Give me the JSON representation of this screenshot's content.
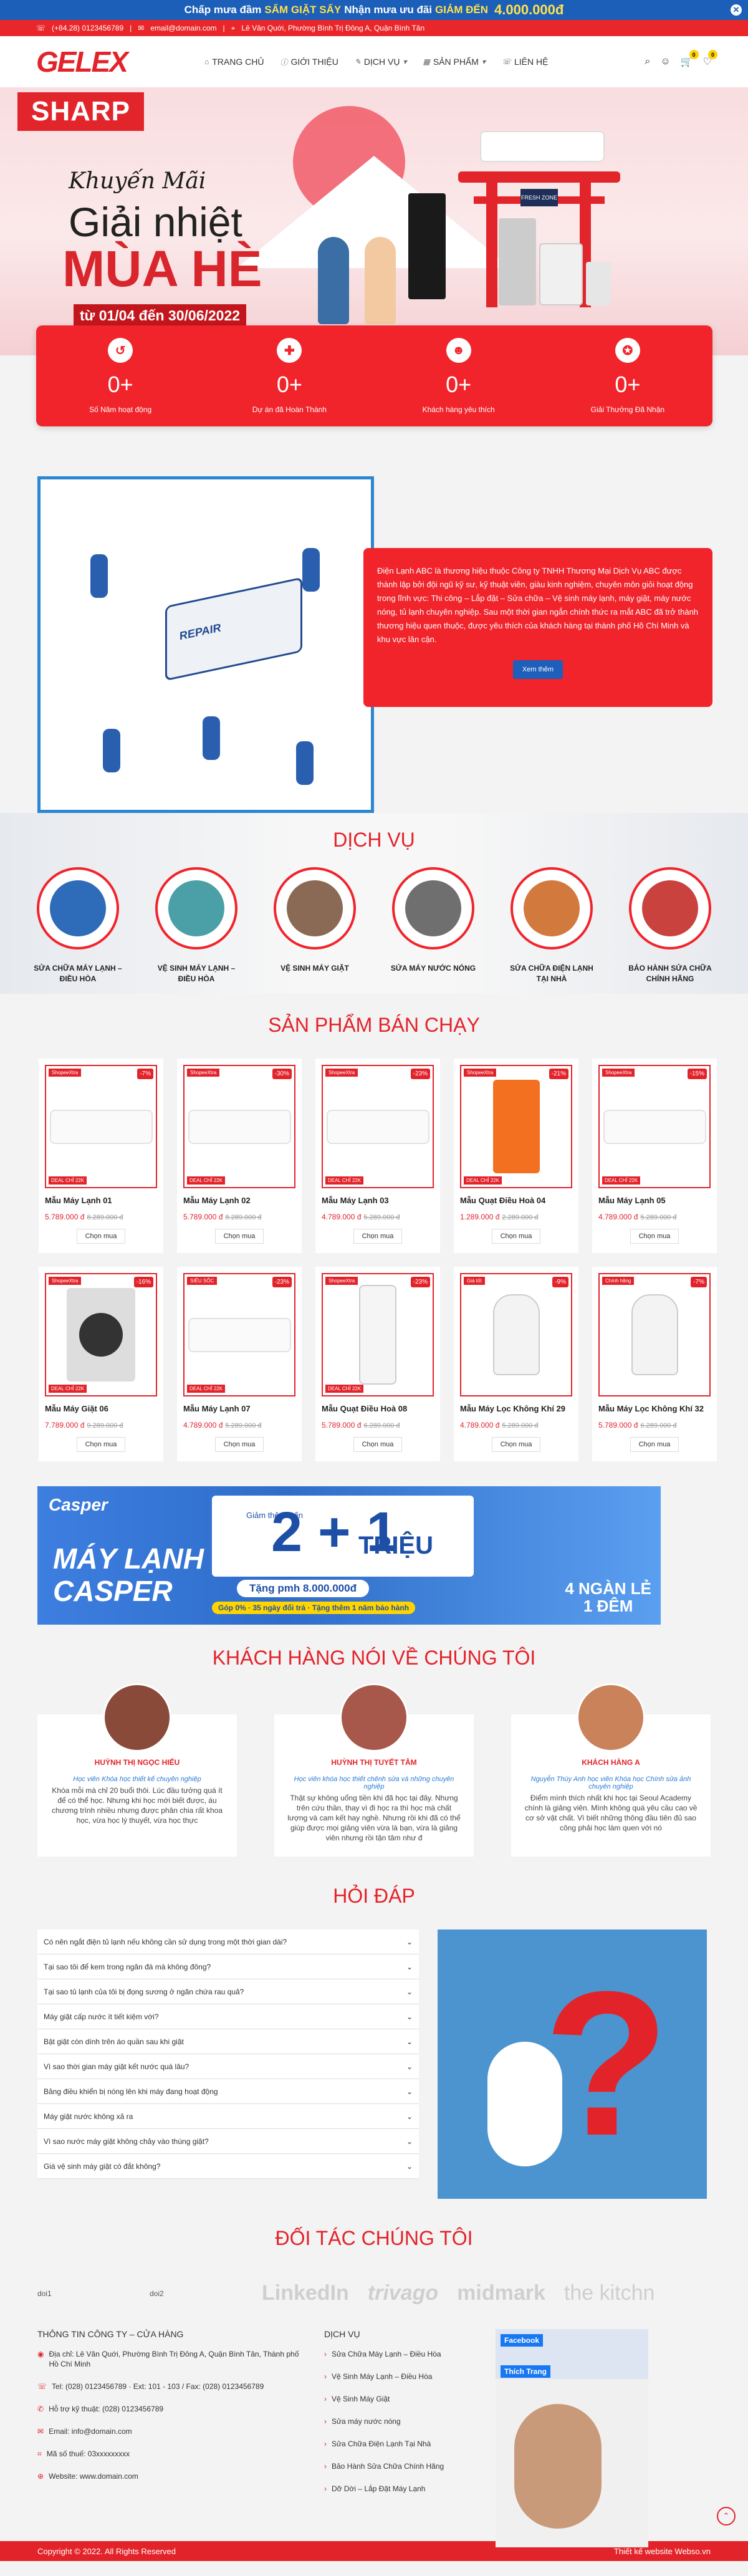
{
  "promo": {
    "text1": "Chấp mưa đầm",
    "hl": "SẤM GIẶT SẤY",
    "text2": "Nhận mưa ưu đãi",
    "hl2": "GIẢM ĐẾN",
    "amount": "4.000.000đ",
    "close": "✕"
  },
  "topbar": {
    "phone": "(+84.28) 0123456789",
    "email": "email@domain.com",
    "address": "Lê Văn Quới, Phường Bình Trị Đông A, Quận Bình Tân"
  },
  "brand": {
    "logo": "GELEX",
    "accent": "#e3232a"
  },
  "nav": [
    {
      "label": "TRANG CHỦ",
      "icon": "home-icon"
    },
    {
      "label": "GIỚI THIỆU",
      "icon": "info-icon"
    },
    {
      "label": "DỊCH VỤ",
      "icon": "wrench-icon"
    },
    {
      "label": "SẢN PHẨM",
      "icon": "grid-icon"
    },
    {
      "label": "LIÊN HỆ",
      "icon": "phone-icon"
    }
  ],
  "header_icons": {
    "cart_count": "0",
    "wish_count": "0"
  },
  "hero": {
    "brand": "SHARP",
    "line1": "Khuyến Mãi",
    "line2": "Giải nhiệt",
    "line3": "MÙA HÈ",
    "dates": "từ 01/04 đến 30/06/2022",
    "sign": "FRESH ZONE"
  },
  "stats": [
    {
      "num": "0+",
      "label": "Số Năm hoạt động",
      "icon": "history-icon"
    },
    {
      "num": "0+",
      "label": "Dự án đã Hoàn Thành",
      "icon": "gift-icon"
    },
    {
      "num": "0+",
      "label": "Khách hàng yêu thích",
      "icon": "users-icon"
    },
    {
      "num": "0+",
      "label": "Giải Thưởng Đã Nhận",
      "icon": "award-icon"
    }
  ],
  "about": {
    "text": "Điện Lạnh ABC là thương hiệu thuộc Công ty TNHH Thương Mại Dịch Vụ ABC được thành lập bởi đội ngũ kỹ sư, kỹ thuật viên, giàu kinh nghiệm, chuyên môn giỏi hoạt động trong lĩnh vực: Thi công – Lắp đặt – Sửa chữa – Vệ sinh máy lạnh, máy giặt, máy nước nóng, tủ lạnh chuyên nghiệp. Sau một thời gian ngắn chính thức ra mắt ABC đã trở thành thương hiệu quen thuộc, được yêu thích của khách hàng tại thành phố Hồ Chí Minh và khu vực lân cận.",
    "button": "Xem thêm",
    "van": "REPAIR"
  },
  "services": {
    "title": "DỊCH VỤ",
    "items": [
      {
        "label": "SỬA CHỮA MÁY LẠNH – ĐIỀU HÒA",
        "color": "#2e6bb8"
      },
      {
        "label": "VỆ SINH MÁY LẠNH – ĐIỀU HÒA",
        "color": "#4aa0a6"
      },
      {
        "label": "VỆ SINH MÁY GIẶT",
        "color": "#8a6a55"
      },
      {
        "label": "SỬA MÁY NƯỚC NÓNG",
        "color": "#6f6f6f"
      },
      {
        "label": "SỬA CHỮA ĐIỆN LẠNH TẠI NHÀ",
        "color": "#d27a3e"
      },
      {
        "label": "BẢO HÀNH SỬA CHỮA CHÍNH HÃNG",
        "color": "#c9423e"
      }
    ]
  },
  "products": {
    "title": "SẢN PHẨM BÁN CHẠY",
    "buy": "Chọn mua",
    "items": [
      {
        "name": "Mẫu Máy Lạnh 01",
        "price": "5.789.000 đ",
        "old": "8.289.000 đ",
        "disc": "-7%",
        "tag": "ShopeeXtra",
        "deal": "DEAL CHỈ 22K",
        "kind": "ac"
      },
      {
        "name": "Mẫu Máy Lạnh 02",
        "price": "5.789.000 đ",
        "old": "8.289.000 đ",
        "disc": "-30%",
        "tag": "ShopeeXtra",
        "deal": "DEAL CHỈ 22K",
        "kind": "ac"
      },
      {
        "name": "Mẫu Máy Lạnh 03",
        "price": "4.789.000 đ",
        "old": "5.289.000 đ",
        "disc": "-23%",
        "tag": "ShopeeXtra",
        "deal": "DEAL CHỈ 22K",
        "kind": "ac"
      },
      {
        "name": "Mẫu Quạt Điều Hoà 04",
        "price": "1.289.000 đ",
        "old": "2.289.000 đ",
        "disc": "-21%",
        "tag": "ShopeeXtra",
        "deal": "DEAL CHỈ 22K",
        "kind": "fan"
      },
      {
        "name": "Mẫu Máy Lạnh 05",
        "price": "4.789.000 đ",
        "old": "5.289.000 đ",
        "disc": "-15%",
        "tag": "ShopeeXtra",
        "deal": "DEAL CHỈ 22K",
        "kind": "ac"
      },
      {
        "name": "Mẫu Máy Giặt 06",
        "price": "7.789.000 đ",
        "old": "9.289.000 đ",
        "disc": "-16%",
        "tag": "ShopeeXtra",
        "deal": "DEAL CHỈ 22K",
        "kind": "washer"
      },
      {
        "name": "Mẫu Máy Lạnh 07",
        "price": "4.789.000 đ",
        "old": "5.289.000 đ",
        "disc": "-23%",
        "tag": "SIÊU SỐC",
        "deal": "DEAL CHỈ 22K",
        "kind": "ac"
      },
      {
        "name": "Mẫu Quạt Điều Hoà 08",
        "price": "5.789.000 đ",
        "old": "6.289.000 đ",
        "disc": "-23%",
        "tag": "ShopeeXtra",
        "deal": "DEAL CHỈ 22K",
        "kind": "cooler"
      },
      {
        "name": "Mẫu Máy Lọc Không Khí 29",
        "price": "4.789.000 đ",
        "old": "5.289.000 đ",
        "disc": "-9%",
        "tag": "Giá tốt",
        "deal": "",
        "kind": "purifier"
      },
      {
        "name": "Mẫu Máy Lọc Không Khí 32",
        "price": "5.789.000 đ",
        "old": "6.289.000 đ",
        "disc": "-7%",
        "tag": "Chính hãng",
        "deal": "",
        "kind": "purifier"
      }
    ]
  },
  "banner": {
    "brand": "Casper",
    "title1": "MÁY LẠNH",
    "title2": "CASPER",
    "gd": "Giảm thêm Đến",
    "n": "2 + 1",
    "tr": "TRIỆU",
    "bar1": "Tặng pmh 8.000.000đ",
    "bar2": "Góp 0% · 35 ngày đổi trả · Tặng thêm 1 năm bảo hành",
    "four1": "4 NGÀN LẺ",
    "four2": "1 ĐÊM"
  },
  "testimonials": {
    "title": "KHÁCH HÀNG NÓI VỀ CHÚNG TÔI",
    "items": [
      {
        "name": "HUỲNH THỊ NGỌC HIẾU",
        "role": "Học viên Khóa học thiết kế chuyên nghiệp",
        "text": "Khóa mỗi mà chỉ 20 buổi thôi. Lúc đầu tưởng quá ít để có thể học. Nhưng khi học mới biết được, áu chương trình nhiều nhưng được phân chia rất khoa học, vừa học lý thuyết, vừa học thực"
      },
      {
        "name": "HUỲNH THỊ TUYẾT TÂM",
        "role": "Học viên khóa học thiết chênh sửa và những chuyên nghiệp",
        "text": "Thật sự không uổng tiền khi đã học tại đây. Nhưng trên cứu thần, thay vì đi học ra thì học mà chất lượng và cam kết hay nghề. Nhưng rồi khi đã có thể giúp được mọi giảng viên vừa là bạn, vừa là giảng viên nhưng rồi tận tâm như đ"
      },
      {
        "name": "KHÁCH HÀNG A",
        "role": "Nguyễn Thùy Anh học viên Khóa học Chính sửa ảnh chuyên nghiệp",
        "text": "Điểm mình thích nhất khi học tại Seoul Academy chính là giảng viên. Mình không quá yêu cầu cao về cơ sở vật chất. Vì biết những thông đầu tiên đủ sao công phải học làm quen với nó"
      }
    ]
  },
  "faq": {
    "title": "HỎI ĐÁP",
    "items": [
      "Có nên ngắt điện tủ lạnh nếu không cần sử dụng trong một thời gian dài?",
      "Tại sao tôi để kem trong ngăn đá mà không đông?",
      "Tại sao tủ lạnh của tôi bị đọng sương ở ngăn chứa rau quả?",
      "Máy giặt cấp nước ít tiết kiệm với?",
      "Bật giặt còn dính trên áo quần sau khi giặt",
      "Vì sao thời gian máy giặt kết nước quá lâu?",
      "Bảng điều khiển bị nóng lên khi máy đang hoạt động",
      "Máy giặt nước không xả ra",
      "Vì sao nước máy giặt không chảy vào thùng giặt?",
      "Giá vệ sinh máy giặt có đắt không?"
    ]
  },
  "partners": {
    "title": "ĐỐI TÁC CHÚNG TÔI",
    "broken": [
      "doi1",
      "doi2"
    ],
    "logos": [
      "LinkedIn",
      "trivago",
      "midmark",
      "the kitchn"
    ]
  },
  "footer": {
    "company_title": "THÔNG TIN CÔNG TY – CỬA HÀNG",
    "address": "Địa chỉ: Lê Văn Quới, Phường Bình Trị Đông A, Quận Bình Tân, Thành phố Hồ Chí Minh",
    "tel": "Tel: (028) 0123456789 · Ext: 101 - 103 / Fax: (028) 0123456789",
    "hotline": "Hỗ trợ kỹ thuật: (028) 0123456789",
    "email": "Email: info@domain.com",
    "tax": "Mã số thuế: 03xxxxxxxxx",
    "web": "Website: www.domain.com",
    "svc_title": "DỊCH VỤ",
    "svc_links": [
      "Sửa Chữa Máy Lạnh – Điều Hòa",
      "Vệ Sinh Máy Lạnh – Điều Hòa",
      "Vệ Sinh Máy Giặt",
      "Sửa máy nước nóng",
      "Sửa Chữa Điện Lạnh Tại Nhà",
      "Bảo Hành Sửa Chữa Chính Hãng",
      "Dỡ Dời – Lắp Đặt Máy Lạnh"
    ],
    "fb_title": "Facebook",
    "fb_like": "Thích Trang",
    "copyright": "Copyright © 2022. All Rights Reserved",
    "credit": "Thiết kế website Webso.vn"
  }
}
